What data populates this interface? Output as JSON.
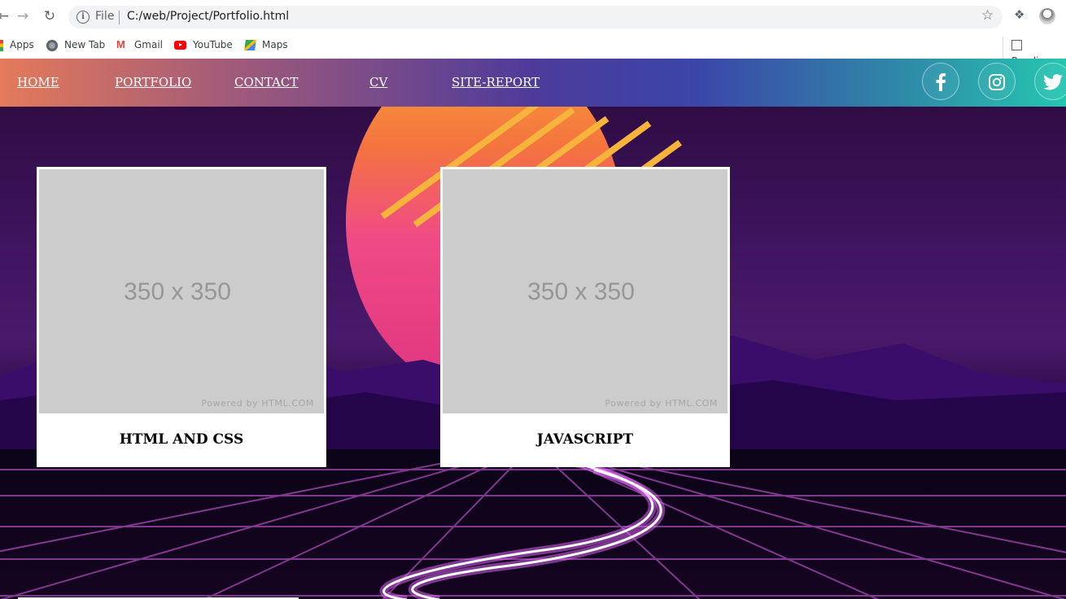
{
  "browser": {
    "file_label": "File",
    "url": "C:/web/Project/Portfolio.html",
    "bookmarks": [
      {
        "label": "Apps",
        "icon": "apps-icon"
      },
      {
        "label": "New Tab",
        "icon": "globe-icon"
      },
      {
        "label": "Gmail",
        "icon": "gmail-icon"
      },
      {
        "label": "YouTube",
        "icon": "youtube-icon"
      },
      {
        "label": "Maps",
        "icon": "maps-icon"
      }
    ],
    "reading_list_label": "Reading"
  },
  "nav": {
    "links": [
      "HOME",
      "PORTFOLIO",
      "CONTACT",
      "CV",
      "SITE-REPORT"
    ],
    "social": [
      {
        "icon": "facebook-icon"
      },
      {
        "icon": "instagram-icon"
      },
      {
        "icon": "twitter-icon"
      }
    ]
  },
  "cards": [
    {
      "placeholder": "350 x 350",
      "powered_by": "Powered by HTML.COM",
      "title": "HTML AND CSS"
    },
    {
      "placeholder": "350 x 350",
      "powered_by": "Powered by HTML.COM",
      "title": "JAVASCRIPT"
    }
  ]
}
